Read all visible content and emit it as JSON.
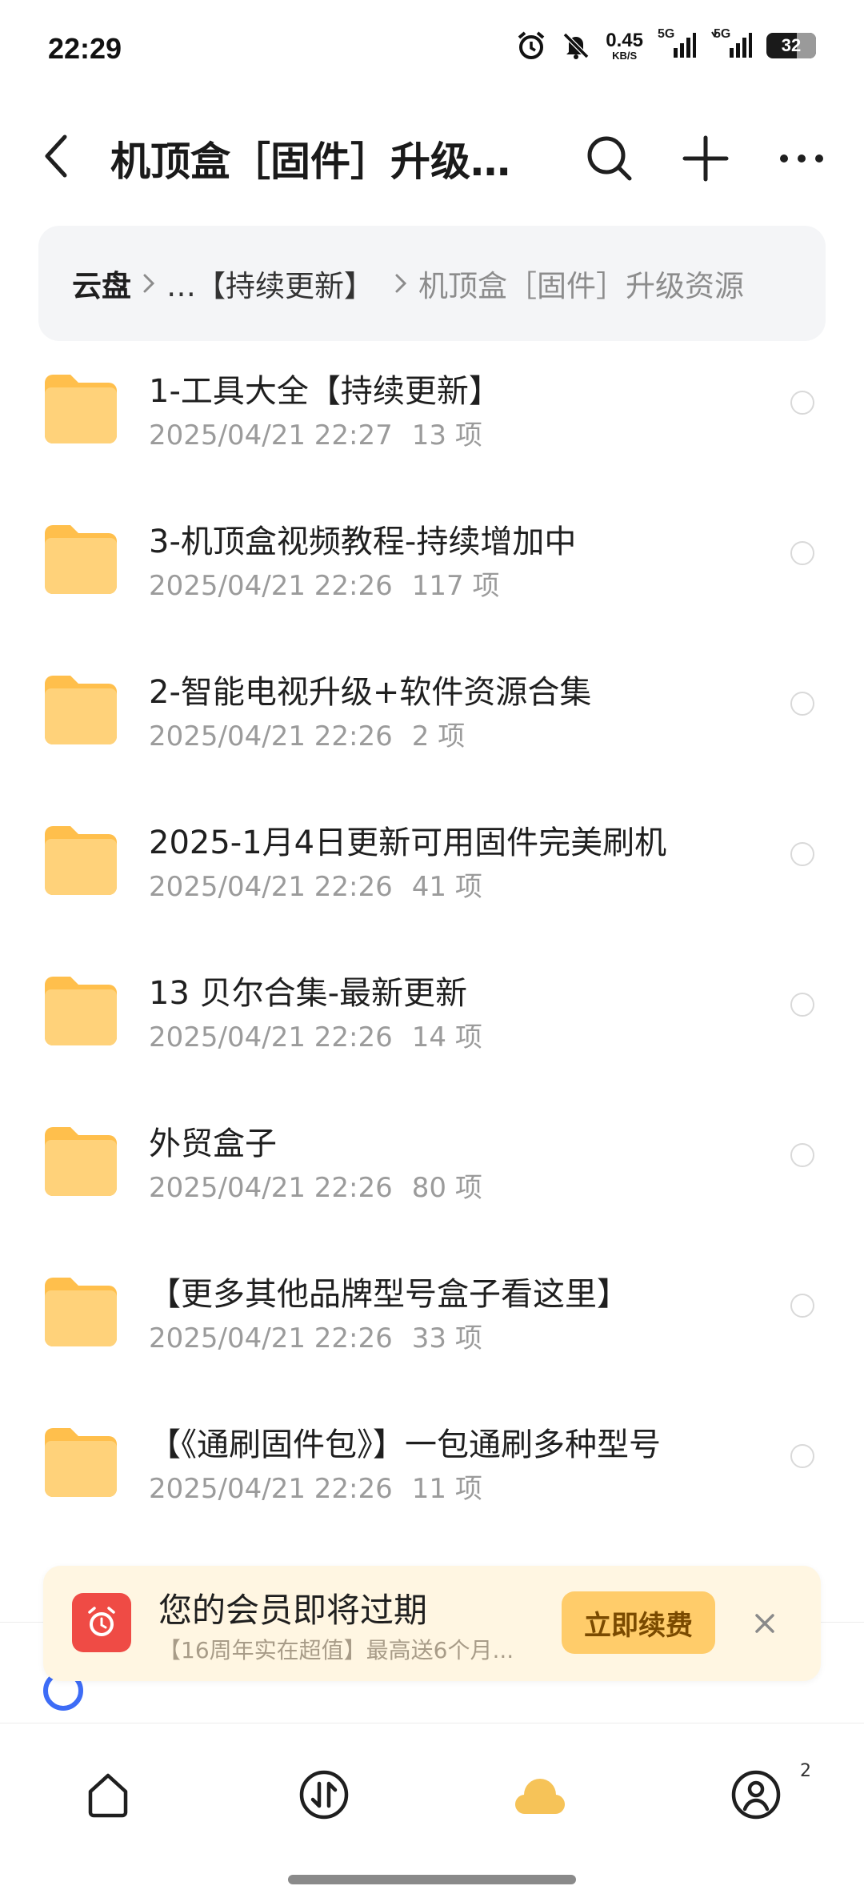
{
  "status_bar": {
    "time": "22:29",
    "net_speed_value": "0.45",
    "net_speed_unit": "KB/S",
    "signal1_label": "5G",
    "signal2_label": "5G",
    "battery_level": "32",
    "icons": [
      "alarm-icon",
      "bell-muted-icon",
      "signal-5g-icon",
      "signal-5g-icon",
      "battery-icon"
    ]
  },
  "header": {
    "title": "机顶盒［固件］升级资源",
    "icons": [
      "back-arrow-icon",
      "search-icon",
      "plus-icon",
      "more-icon"
    ]
  },
  "breadcrumb": {
    "root": "云盘",
    "middle": "​…【持续更新】",
    "current": "机顶盒［固件］升级资源"
  },
  "files": [
    {
      "name": "1-工具大全【持续更新】",
      "date": "2025/04/21 22:27",
      "count": "13 项"
    },
    {
      "name": "3-机顶盒视频教程-持续增加中",
      "date": "2025/04/21 22:26",
      "count": "117 项"
    },
    {
      "name": "2-智能电视升级+软件资源合集",
      "date": "2025/04/21 22:26",
      "count": "2 项"
    },
    {
      "name": "2025-1月4日更新可用固件完美刷机",
      "date": "2025/04/21 22:26",
      "count": "41 项"
    },
    {
      "name": "13 贝尔合集-最新更新",
      "date": "2025/04/21 22:26",
      "count": "14 项"
    },
    {
      "name": "外贸盒子",
      "date": "2025/04/21 22:26",
      "count": "80 项"
    },
    {
      "name": "【更多其他品牌型号盒子看这里】",
      "date": "2025/04/21 22:26",
      "count": "33 项"
    },
    {
      "name": "【《通刷固件包》】一包通刷多种型号",
      "date": "2025/04/21 22:26",
      "count": "11 项"
    }
  ],
  "vip_banner": {
    "title": "您的会员即将过期",
    "subtitle": "【16周年实在超值】最高送6个月...",
    "button": "立即续费"
  },
  "bottom_nav": {
    "items": [
      "home-icon",
      "transfer-icon",
      "cloud-icon",
      "profile-icon"
    ],
    "profile_badge": "2"
  },
  "colors": {
    "folder": "#ffc65a",
    "accent": "#3d6cf6",
    "vip_bg": "#fff6e2",
    "vip_button": "#ffcc6a",
    "cloud_active": "#f6c358"
  }
}
